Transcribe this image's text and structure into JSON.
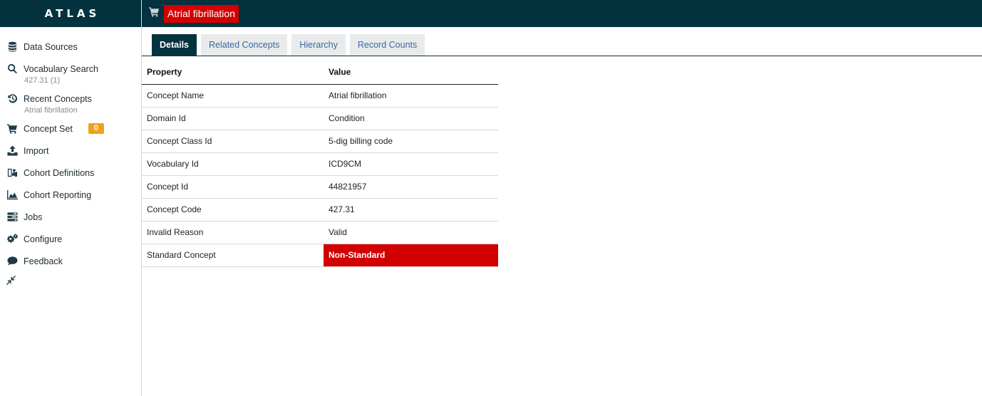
{
  "app": {
    "brand": "ATLAS"
  },
  "sidebar": {
    "items": [
      {
        "label": "Data Sources",
        "icon": "database-icon"
      },
      {
        "label": "Vocabulary Search",
        "icon": "search-icon",
        "sub": "427.31 (1)"
      },
      {
        "label": "Recent Concepts",
        "icon": "history-icon",
        "sub": "Atrial fibrillation"
      },
      {
        "label": "Concept Set",
        "icon": "cart-icon",
        "badge": "0"
      },
      {
        "label": "Import",
        "icon": "upload-icon"
      },
      {
        "label": "Cohort Definitions",
        "icon": "cohort-icon"
      },
      {
        "label": "Cohort Reporting",
        "icon": "chart-area-icon"
      },
      {
        "label": "Jobs",
        "icon": "tasks-icon"
      },
      {
        "label": "Configure",
        "icon": "gears-icon"
      },
      {
        "label": "Feedback",
        "icon": "comment-icon"
      }
    ],
    "collapse_icon": "compress-icon"
  },
  "header": {
    "title": "Atrial fibrillation",
    "title_color": "#d40000",
    "bar_color": "#04323f"
  },
  "tabs": [
    {
      "label": "Details",
      "active": true
    },
    {
      "label": "Related Concepts",
      "active": false
    },
    {
      "label": "Hierarchy",
      "active": false
    },
    {
      "label": "Record Counts",
      "active": false
    }
  ],
  "details": {
    "columns": [
      "Property",
      "Value"
    ],
    "rows": [
      {
        "property": "Concept Name",
        "value": "Atrial fibrillation"
      },
      {
        "property": "Domain Id",
        "value": "Condition"
      },
      {
        "property": "Concept Class Id",
        "value": "5-dig billing code"
      },
      {
        "property": "Vocabulary Id",
        "value": "ICD9CM"
      },
      {
        "property": "Concept Id",
        "value": "44821957"
      },
      {
        "property": "Concept Code",
        "value": "427.31"
      },
      {
        "property": "Invalid Reason",
        "value": "Valid"
      },
      {
        "property": "Standard Concept",
        "value": "Non-Standard"
      }
    ]
  }
}
